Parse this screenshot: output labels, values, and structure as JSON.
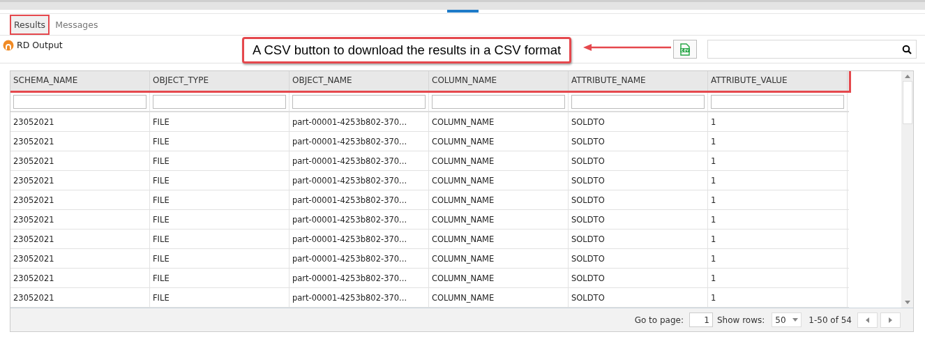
{
  "tabs": [
    {
      "label": "Results",
      "selected": true,
      "annotated": true
    },
    {
      "label": "Messages",
      "selected": false,
      "annotated": false
    }
  ],
  "output_title": "RD Output",
  "callout": {
    "text": "A CSV button to download the results in a CSV format"
  },
  "table": {
    "header_annotated": true,
    "columns": [
      "SCHEMA_NAME",
      "OBJECT_TYPE",
      "OBJECT_NAME",
      "COLUMN_NAME",
      "ATTRIBUTE_NAME",
      "ATTRIBUTE_VALUE"
    ],
    "rows": [
      [
        "23052021",
        "FILE",
        "part-00001-4253b802-370...",
        "COLUMN_NAME",
        "SOLDTO",
        "1"
      ],
      [
        "23052021",
        "FILE",
        "part-00001-4253b802-370...",
        "COLUMN_NAME",
        "SOLDTO",
        "1"
      ],
      [
        "23052021",
        "FILE",
        "part-00001-4253b802-370...",
        "COLUMN_NAME",
        "SOLDTO",
        "1"
      ],
      [
        "23052021",
        "FILE",
        "part-00001-4253b802-370...",
        "COLUMN_NAME",
        "SOLDTO",
        "1"
      ],
      [
        "23052021",
        "FILE",
        "part-00001-4253b802-370...",
        "COLUMN_NAME",
        "SOLDTO",
        "1"
      ],
      [
        "23052021",
        "FILE",
        "part-00001-4253b802-370...",
        "COLUMN_NAME",
        "SOLDTO",
        "1"
      ],
      [
        "23052021",
        "FILE",
        "part-00001-4253b802-370...",
        "COLUMN_NAME",
        "SOLDTO",
        "1"
      ],
      [
        "23052021",
        "FILE",
        "part-00001-4253b802-370...",
        "COLUMN_NAME",
        "SOLDTO",
        "1"
      ],
      [
        "23052021",
        "FILE",
        "part-00001-4253b802-370...",
        "COLUMN_NAME",
        "SOLDTO",
        "1"
      ],
      [
        "23052021",
        "FILE",
        "part-00001-4253b802-370...",
        "COLUMN_NAME",
        "SOLDTO",
        "1"
      ]
    ]
  },
  "pager": {
    "goto_label": "Go to page:",
    "page": "1",
    "rows_label": "Show rows:",
    "rows_value": "50",
    "range": "1-50 of 54"
  }
}
